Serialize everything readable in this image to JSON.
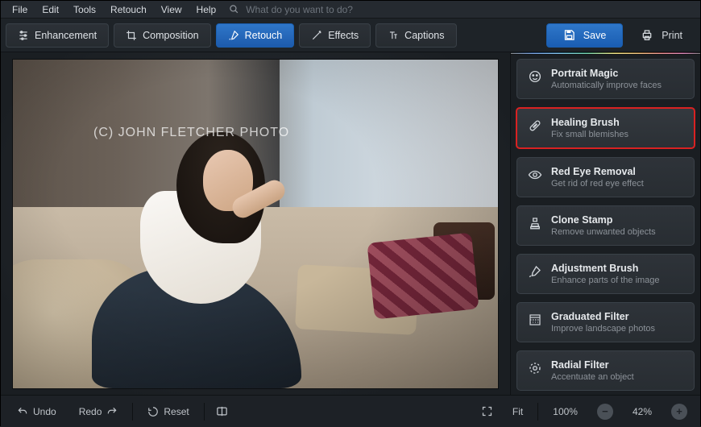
{
  "menu": {
    "items": [
      "File",
      "Edit",
      "Tools",
      "Retouch",
      "View",
      "Help"
    ],
    "search_placeholder": "What do you want to do?"
  },
  "toolbar": {
    "enhancement": "Enhancement",
    "composition": "Composition",
    "retouch": "Retouch",
    "effects": "Effects",
    "captions": "Captions",
    "save": "Save",
    "print": "Print",
    "active": "retouch"
  },
  "photo": {
    "watermark": "(C) JOHN FLETCHER PHOTO"
  },
  "retouch_tools": [
    {
      "id": "portrait-magic",
      "icon": "face-icon",
      "title": "Portrait Magic",
      "desc": "Automatically improve faces"
    },
    {
      "id": "healing-brush",
      "icon": "bandage-icon",
      "title": "Healing Brush",
      "desc": "Fix small blemishes",
      "highlighted": true
    },
    {
      "id": "red-eye",
      "icon": "eye-icon",
      "title": "Red Eye Removal",
      "desc": "Get rid of red eye effect"
    },
    {
      "id": "clone-stamp",
      "icon": "stamp-icon",
      "title": "Clone Stamp",
      "desc": "Remove unwanted objects"
    },
    {
      "id": "adjustment-brush",
      "icon": "brush-icon",
      "title": "Adjustment Brush",
      "desc": "Enhance parts of the image"
    },
    {
      "id": "graduated-filter",
      "icon": "gradient-icon",
      "title": "Graduated Filter",
      "desc": "Improve landscape photos"
    },
    {
      "id": "radial-filter",
      "icon": "radial-icon",
      "title": "Radial Filter",
      "desc": "Accentuate an object"
    }
  ],
  "bottombar": {
    "undo": "Undo",
    "redo": "Redo",
    "reset": "Reset",
    "fit": "Fit",
    "zoom_full": "100%",
    "zoom_current": "42%"
  }
}
